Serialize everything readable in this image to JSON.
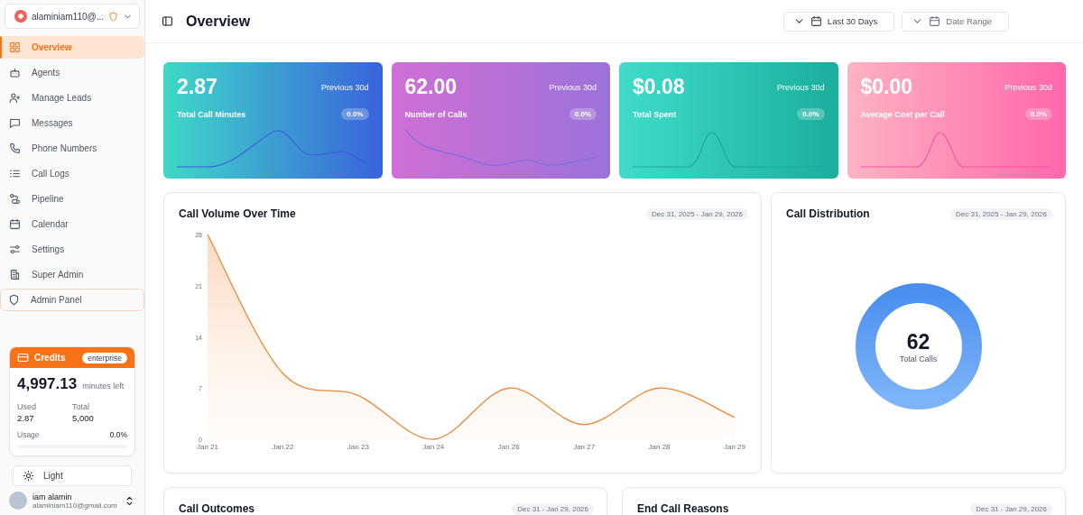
{
  "account": {
    "name": "alaminiam110@..."
  },
  "sidebar": {
    "items": [
      {
        "label": "Overview",
        "selected": true,
        "kind": "nav"
      },
      {
        "label": "Agents",
        "selected": false,
        "kind": "nav"
      },
      {
        "label": "Manage Leads",
        "selected": false,
        "kind": "nav"
      },
      {
        "label": "Messages",
        "selected": false,
        "kind": "nav"
      },
      {
        "label": "Phone Numbers",
        "selected": false,
        "kind": "nav"
      },
      {
        "label": "Call Logs",
        "selected": false,
        "kind": "nav"
      },
      {
        "label": "Pipeline",
        "selected": false,
        "kind": "nav"
      },
      {
        "label": "Calendar",
        "selected": false,
        "kind": "nav"
      },
      {
        "label": "Settings",
        "selected": false,
        "kind": "nav"
      },
      {
        "label": "Super Admin",
        "selected": false,
        "kind": "nav"
      },
      {
        "label": "Admin Panel",
        "selected": false,
        "kind": "admin"
      }
    ]
  },
  "credits": {
    "title": "Credits",
    "plan": "enterprise",
    "remaining": "4,997.13",
    "remaining_unit": "minutes left",
    "used_label": "Used",
    "used": "2.87",
    "total_label": "Total",
    "total": "5,000",
    "usage_label": "Usage",
    "usage": "0.0%",
    "level": 0
  },
  "theme_button": {
    "label": "Light"
  },
  "user": {
    "name": "iam alamin",
    "email": "alaminiam110@gmail.com"
  },
  "header": {
    "title": "Overview",
    "filters": [
      {
        "label": "Last 30 Days",
        "kind": "value"
      },
      {
        "label": "Date Range",
        "kind": "placeholder"
      }
    ]
  },
  "stats": [
    {
      "value": "2.87",
      "compare": "Previous 30d",
      "label": "Total Call Minutes",
      "change": "0.0%",
      "kind": "minutes",
      "color": "#3a5fd9"
    },
    {
      "value": "62.00",
      "compare": "Previous 30d",
      "label": "Number of Calls",
      "change": "0.0%",
      "kind": "calls",
      "color": "#7a6fd8"
    },
    {
      "value": "$0.08",
      "compare": "Previous 30d",
      "label": "Total Spent",
      "change": "0.0%",
      "kind": "spent",
      "color": "#17a896"
    },
    {
      "value": "$0.00",
      "compare": "Previous 30d",
      "label": "Average Cost per Call",
      "change": "0.0%",
      "kind": "cost",
      "color": "#f2559a"
    }
  ],
  "volume": {
    "title": "Call Volume Over Time",
    "range": "Dec 31, 2025 - Jan 29, 2026",
    "chart_data": {
      "type": "area",
      "categories": [
        "Jan 21",
        "Jan 22",
        "Jan 23",
        "Jan 24",
        "Jan 26",
        "Jan 27",
        "Jan 28",
        "Jan 29"
      ],
      "series": [
        {
          "color": "#e8893a",
          "values": [
            28,
            9,
            6,
            0,
            7,
            2,
            7,
            3
          ]
        }
      ],
      "ylim": [
        0,
        28
      ],
      "yticks": [
        0,
        7,
        14,
        21,
        28
      ]
    }
  },
  "distribution": {
    "title": "Call Distribution",
    "range": "Dec 31, 2025 - Jan 29, 2026",
    "total": "62",
    "total_label": "Total Calls"
  },
  "bottom_cards": [
    {
      "title": "Call Outcomes",
      "range": "Dec 31 - Jan 29, 2026"
    },
    {
      "title": "End Call Reasons",
      "range": "Dec 31 - Jan 29, 2026"
    }
  ]
}
